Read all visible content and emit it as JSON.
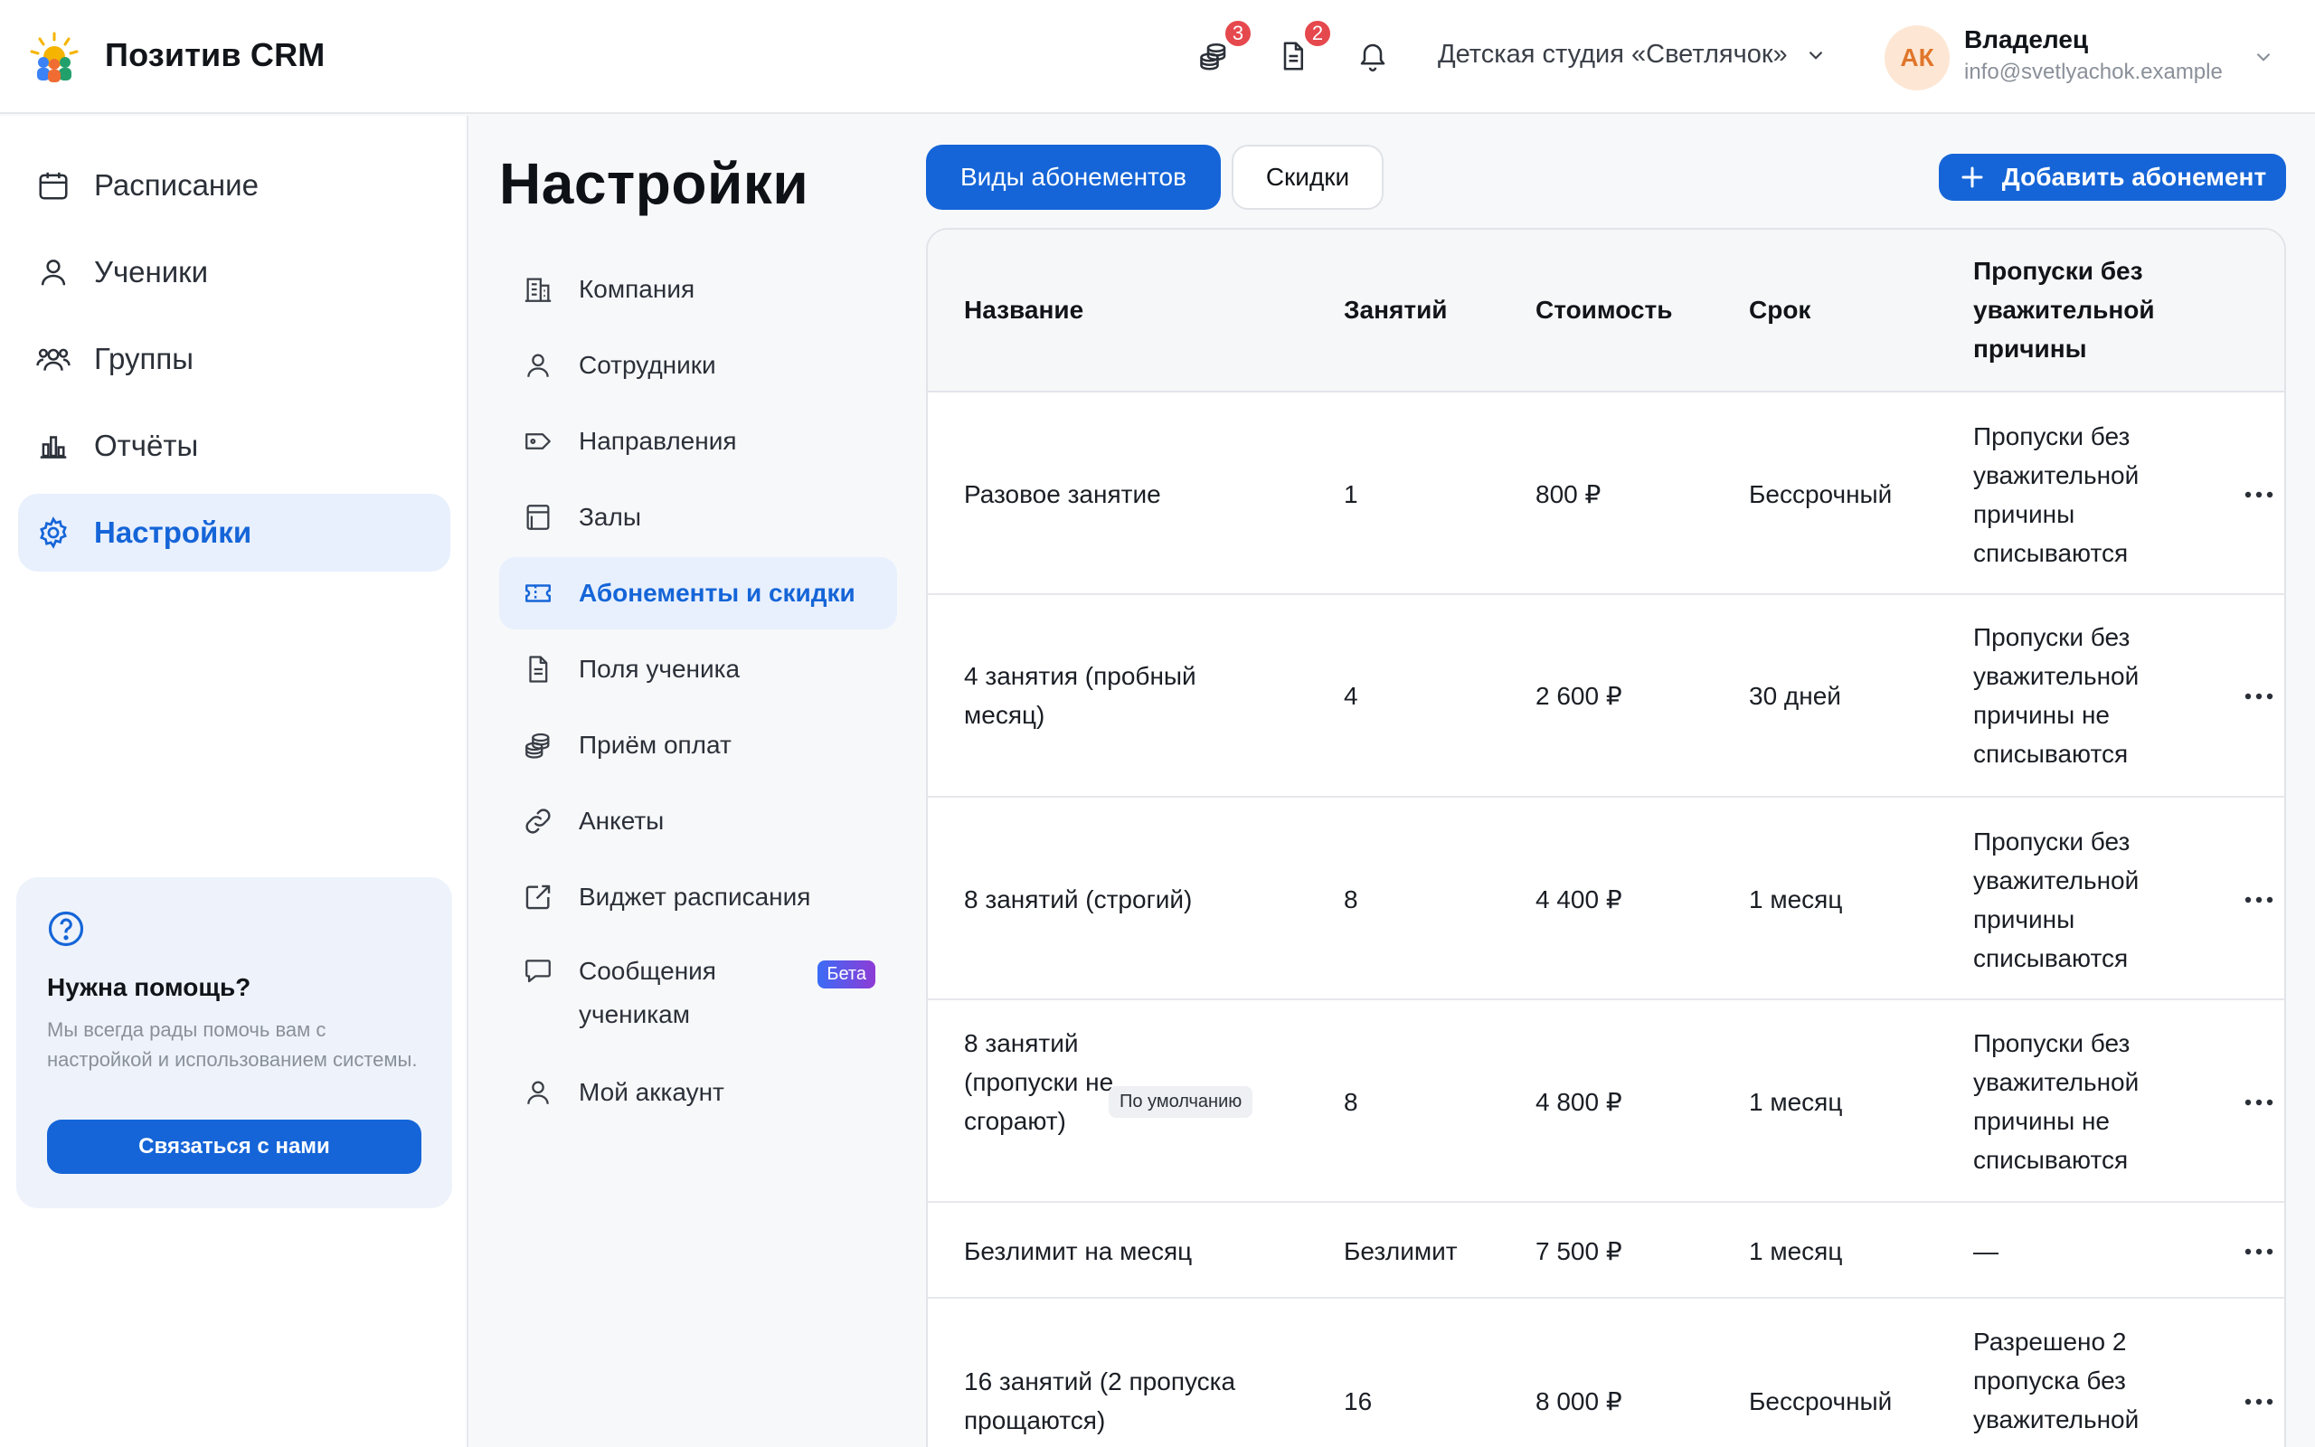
{
  "app": {
    "brand": "Позитив CRM",
    "notifications": {
      "payments_count": "3",
      "documents_count": "2"
    },
    "studio_name": "Детская студия «Светлячок»",
    "user": {
      "initials": "АК",
      "role": "Владелец",
      "email": "info@svetlyachok.example"
    }
  },
  "sidebar": {
    "items": [
      {
        "label": "Расписание",
        "icon": "calendar-icon"
      },
      {
        "label": "Ученики",
        "icon": "user-icon"
      },
      {
        "label": "Группы",
        "icon": "users-icon"
      },
      {
        "label": "Отчёты",
        "icon": "chart-icon"
      },
      {
        "label": "Настройки",
        "icon": "gear-icon",
        "active": true
      }
    ],
    "help": {
      "title": "Нужна помощь?",
      "text": "Мы всегда рады помочь вам с настройкой и использованием системы.",
      "button": "Связаться с нами"
    }
  },
  "settings": {
    "title": "Настройки",
    "nav": [
      {
        "label": "Компания",
        "icon": "building-icon"
      },
      {
        "label": "Сотрудники",
        "icon": "user-icon"
      },
      {
        "label": "Направления",
        "icon": "tag-icon"
      },
      {
        "label": "Залы",
        "icon": "room-icon"
      },
      {
        "label": "Абонементы и скидки",
        "icon": "ticket-icon",
        "active": true
      },
      {
        "label": "Поля ученика",
        "icon": "document-icon"
      },
      {
        "label": "Приём оплат",
        "icon": "coins-icon"
      },
      {
        "label": "Анкеты",
        "icon": "link-icon"
      },
      {
        "label": "Виджет расписания",
        "icon": "external-link-icon"
      },
      {
        "label": "Сообщения ученикам",
        "icon": "chat-icon",
        "badge": "Бета"
      },
      {
        "label": "Мой аккаунт",
        "icon": "user-icon"
      }
    ]
  },
  "tabs": {
    "active": "Виды абонементов",
    "inactive": "Скидки"
  },
  "add_button": "Добавить абонемент",
  "table": {
    "columns": [
      "Название",
      "Занятий",
      "Стоимость",
      "Срок",
      "Пропуски без уважительной причины"
    ],
    "rows": [
      {
        "name": "Разовое занятие",
        "lessons": "1",
        "price": "800 ₽",
        "term": "Бессрочный",
        "absences": "Пропуски без уважительной причины списываются"
      },
      {
        "name": "4 занятия (пробный месяц)",
        "lessons": "4",
        "price": "2 600 ₽",
        "term": "30 дней",
        "absences": "Пропуски без уважительной причины не списываются"
      },
      {
        "name": "8 занятий (строгий)",
        "lessons": "8",
        "price": "4 400 ₽",
        "term": "1 месяц",
        "absences": "Пропуски без уважительной причины списываются"
      },
      {
        "name": "8 занятий (пропуски не сгорают)",
        "tag": "По умолчанию",
        "lessons": "8",
        "price": "4 800 ₽",
        "term": "1 месяц",
        "absences": "Пропуски без уважительной причины не списываются"
      },
      {
        "name": "Безлимит на месяц",
        "lessons": "Безлимит",
        "price": "7 500 ₽",
        "term": "1 месяц",
        "absences": "—"
      },
      {
        "name": "16 занятий (2 пропуска прощаются)",
        "lessons": "16",
        "price": "8 000 ₽",
        "term": "Бессрочный",
        "absences": "Разрешено 2 пропуска без уважительной"
      }
    ]
  },
  "colors": {
    "accent": "#1565d8",
    "badge": "#e5484d",
    "avatar_bg": "#fde7d4",
    "avatar_fg": "#e0762b"
  }
}
